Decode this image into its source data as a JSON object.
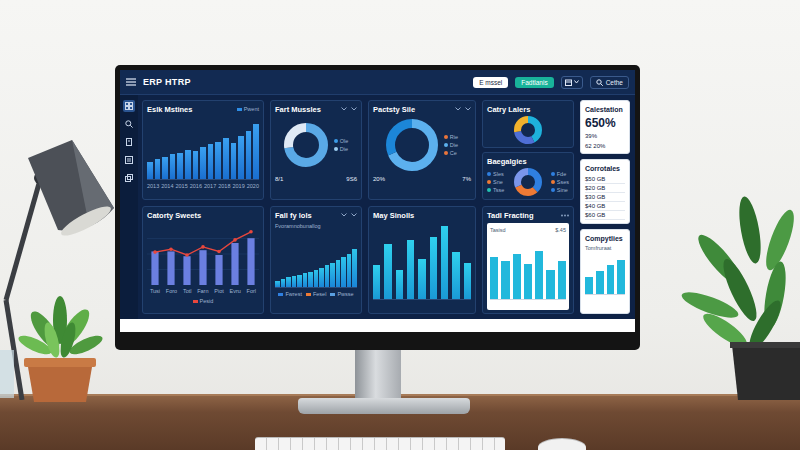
{
  "topbar": {
    "title": "ERP HTRP",
    "field": "E mssel",
    "button": "Fadtlanis",
    "search": "Cethe"
  },
  "sidebar": {
    "items": [
      {
        "selected": true
      },
      {
        "selected": false
      },
      {
        "selected": false
      },
      {
        "selected": false
      },
      {
        "selected": false
      }
    ]
  },
  "metrics": {
    "title": "Eslk Mstines",
    "legend": "Pwent",
    "values": [
      28,
      33,
      36,
      40,
      42,
      47,
      45,
      52,
      56,
      60,
      66,
      58,
      70,
      78,
      88
    ],
    "ticks": [
      "2013",
      "2014",
      "2015",
      "2016",
      "2017",
      "2018",
      "2019",
      "2020"
    ]
  },
  "muscles": {
    "title": "Fart Mussles",
    "segments": [
      {
        "value": 72,
        "color": "#5aa9e6"
      },
      {
        "value": 28,
        "color": "#dfe9f5"
      }
    ],
    "legend": [
      {
        "label": "Ole",
        "color": "#3a9be8"
      },
      {
        "label": "Die",
        "color": "#9ccdf0"
      }
    ],
    "stats": [
      "8/1",
      "9S6"
    ]
  },
  "style": {
    "title": "Pactsty Sile",
    "segments": [
      {
        "value": 68,
        "color": "#5cb0ee"
      },
      {
        "value": 32,
        "color": "#1c86d8"
      }
    ],
    "legend": [
      {
        "label": "Rie",
        "color": "#e8743b"
      },
      {
        "label": "Die",
        "color": "#5cb0ee"
      },
      {
        "label": "Ce",
        "color": "#e8743b"
      }
    ],
    "stats": [
      "20%",
      "7%"
    ]
  },
  "lalers": {
    "title": "Catry Lalers",
    "segments": [
      {
        "value": 42,
        "color": "#1eb2dc"
      },
      {
        "value": 30,
        "color": "#4f6fd6"
      },
      {
        "value": 28,
        "color": "#f2b22c"
      }
    ]
  },
  "budgets": {
    "title": "Baegalgies",
    "segments": [
      {
        "value": 38,
        "color": "#2f7fe0"
      },
      {
        "value": 30,
        "color": "#ee7a35"
      },
      {
        "value": 32,
        "color": "#7b96ea"
      }
    ],
    "legend": [
      {
        "label": "Sles",
        "color": "#2f7fe0"
      },
      {
        "label": "Sne",
        "color": "#ee7a35"
      },
      {
        "label": "Tsse",
        "color": "#22c2b2"
      },
      {
        "label": "Fde",
        "color": "#2f7fe0"
      },
      {
        "label": "Sses",
        "color": "#ee7a35"
      },
      {
        "label": "Sine",
        "color": "#2f7fe0"
      }
    ]
  },
  "calc": {
    "title": "Calestation",
    "values": [
      "650%",
      "39%",
      "62 20%"
    ]
  },
  "corro": {
    "title": "Corrotales",
    "rows": [
      "$50 GB",
      "$20 GB",
      "$30 GB",
      "$40 GB",
      "$60 GB"
    ]
  },
  "sweets": {
    "title": "Catorty Sweets",
    "bars": [
      56,
      56,
      48,
      58,
      50,
      70,
      78
    ],
    "line": [
      55,
      60,
      50,
      64,
      56,
      76,
      90
    ],
    "labels": [
      "Tusi",
      "Foro",
      "Totl",
      "Farn",
      "Piot",
      "Evru",
      "Forl"
    ],
    "legend": "Pesid"
  },
  "fall": {
    "title": "Fall fy lols",
    "caption": "Fvoramnobunallog",
    "values": [
      12,
      14,
      18,
      20,
      22,
      26,
      28,
      32,
      35,
      40,
      44,
      50,
      55,
      62,
      70
    ],
    "legend": [
      {
        "label": "Fwrest",
        "color": "#2f7fe0"
      },
      {
        "label": "Fesel",
        "color": "#ee7a35"
      },
      {
        "label": "Pwsse",
        "color": "#5a9fe0"
      }
    ]
  },
  "may": {
    "title": "May Sinolls",
    "values": [
      45,
      72,
      38,
      78,
      52,
      82,
      96,
      62,
      48
    ]
  },
  "tadl": {
    "title": "Tadl Fracting",
    "legend": "Tasisd",
    "note": "$.45",
    "values": [
      68,
      62,
      72,
      56,
      78,
      46,
      62
    ]
  },
  "compy": {
    "title": "Compytlies",
    "caption": "Tomfruraat",
    "values": [
      42,
      58,
      72,
      84
    ]
  }
}
